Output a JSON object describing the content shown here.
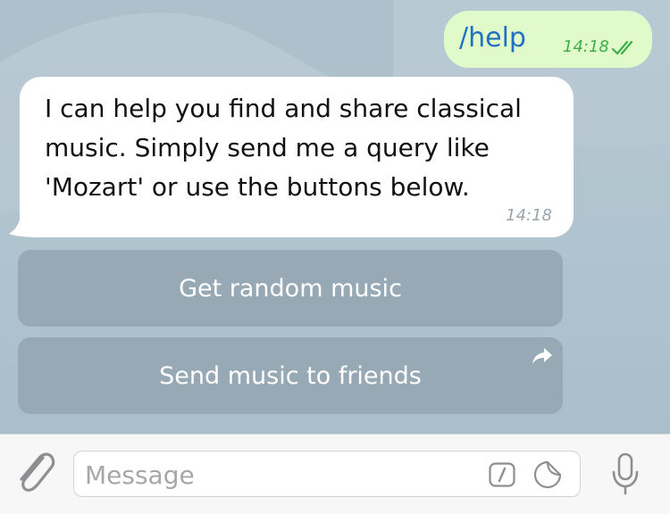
{
  "chat": {
    "messages": [
      {
        "direction": "outgoing",
        "text": "/help",
        "time": "14:18",
        "status": "read"
      },
      {
        "direction": "incoming",
        "text": "I can help you find and share classical music. Simply send me a query like 'Mozart' or use the buttons below.",
        "time": "14:18"
      }
    ],
    "inline_keyboard": [
      {
        "label": "Get random music",
        "icon": null
      },
      {
        "label": "Send music to friends",
        "icon": "share-arrow-icon"
      }
    ]
  },
  "composer": {
    "placeholder": "Message",
    "icons": [
      "paperclip-icon",
      "bot-command-icon",
      "sticker-icon",
      "microphone-icon"
    ]
  },
  "colors": {
    "outgoing_bubble": "#e0fbc9",
    "outgoing_text": "#1f6fc5",
    "outgoing_time": "#3fae4a",
    "incoming_bubble": "#ffffff",
    "keyboard_button": "#8fa0ac",
    "input_bar": "#f7f7f7"
  }
}
